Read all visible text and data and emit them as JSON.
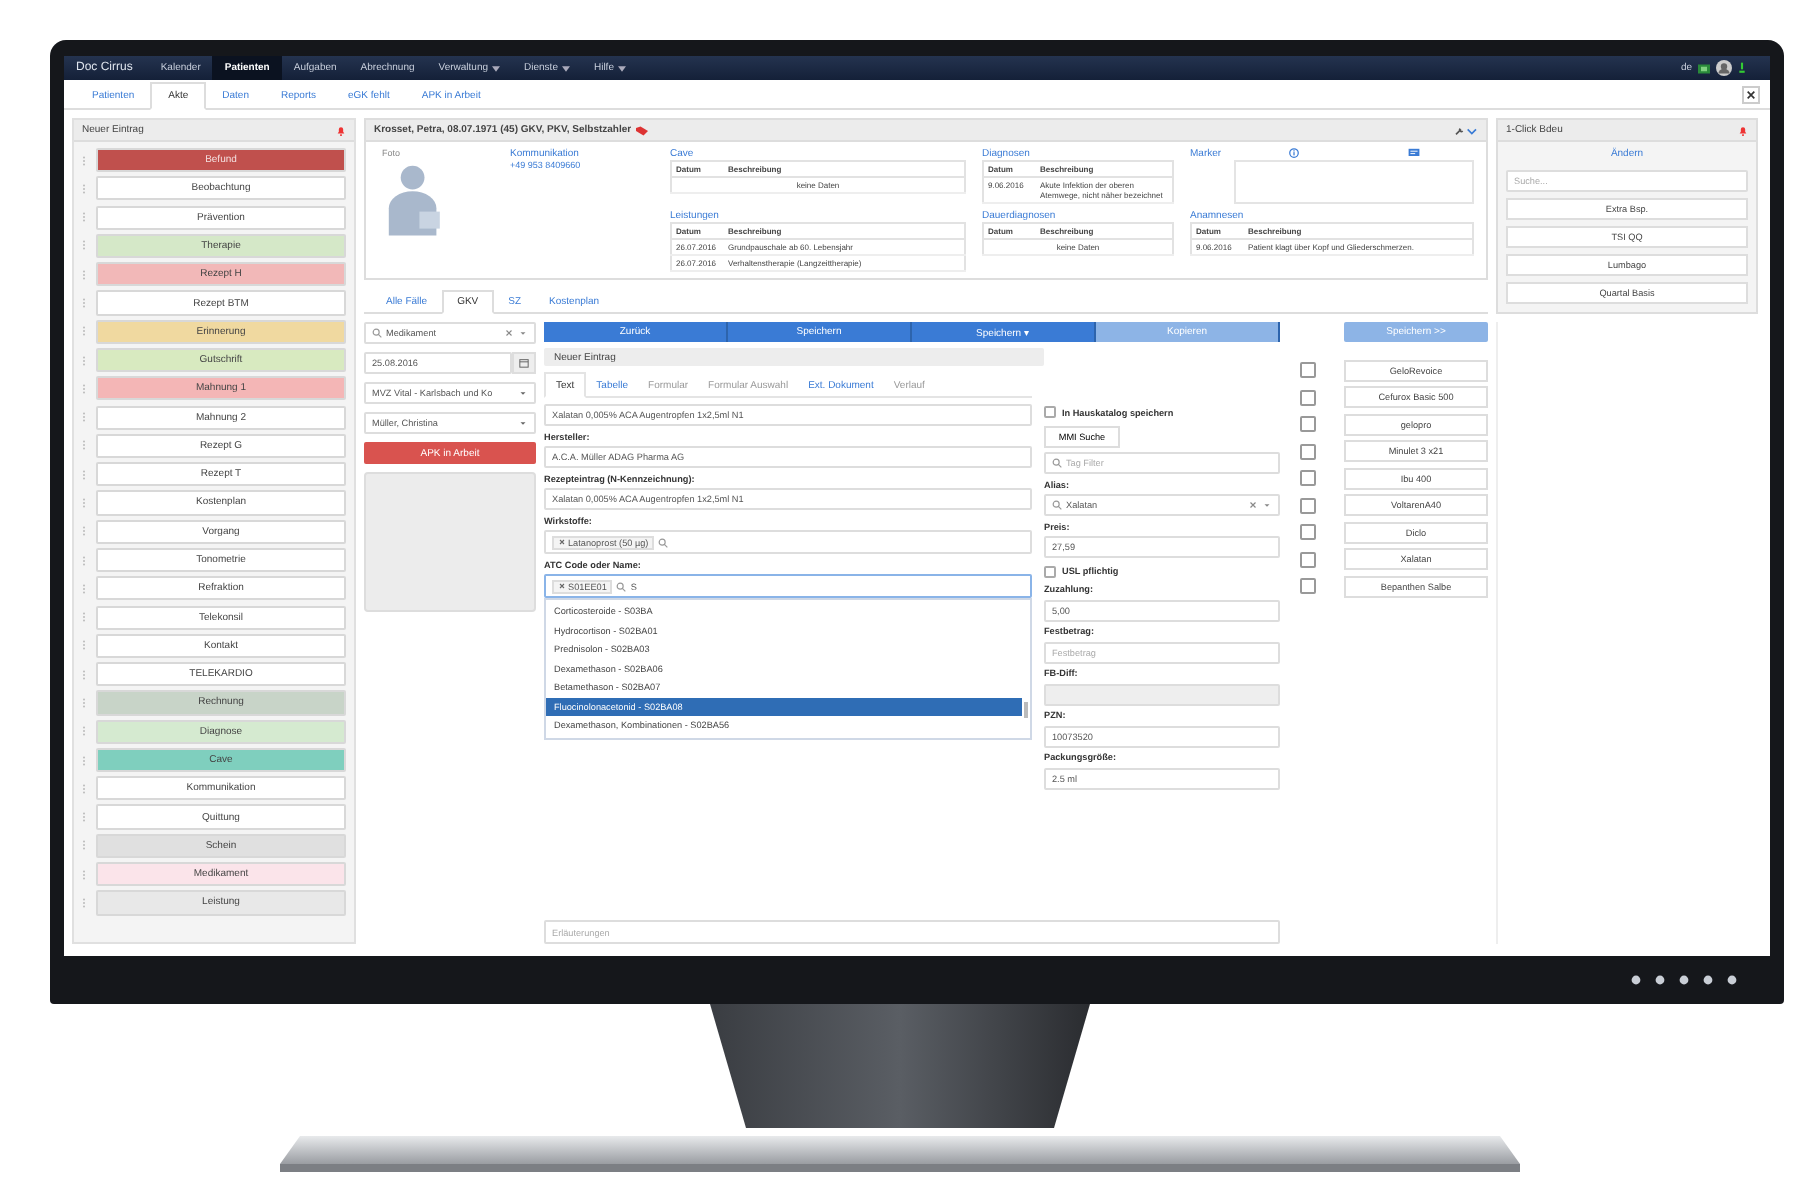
{
  "app_name": "Doc Cirrus",
  "nav": [
    {
      "label": "Kalender",
      "selected": false,
      "dropdown": false
    },
    {
      "label": "Patienten",
      "selected": true,
      "dropdown": false
    },
    {
      "label": "Aufgaben",
      "selected": false,
      "dropdown": false
    },
    {
      "label": "Abrechnung",
      "selected": false,
      "dropdown": false
    },
    {
      "label": "Verwaltung",
      "selected": false,
      "dropdown": true
    },
    {
      "label": "Dienste",
      "selected": false,
      "dropdown": true
    },
    {
      "label": "Hilfe",
      "selected": false,
      "dropdown": true
    }
  ],
  "language": "de",
  "subtabs": [
    {
      "label": "Patienten",
      "selected": false
    },
    {
      "label": "Akte",
      "selected": true
    },
    {
      "label": "Daten",
      "selected": false
    },
    {
      "label": "Reports",
      "selected": false
    },
    {
      "label": "eGK fehlt",
      "selected": false
    },
    {
      "label": "APK in Arbeit",
      "selected": false
    }
  ],
  "new_entry_panel": {
    "title": "Neuer Eintrag",
    "items": [
      {
        "label": "Befund",
        "color": "#c0504d"
      },
      {
        "label": "Beobachtung",
        "color": "#ffffff"
      },
      {
        "label": "Prävention",
        "color": "#ffffff"
      },
      {
        "label": "Therapie",
        "color": "#d5e8c8"
      },
      {
        "label": "Rezept H",
        "color": "#f2b8b8"
      },
      {
        "label": "Rezept BTM",
        "color": "#ffffff"
      },
      {
        "label": "Erinnerung",
        "color": "#f0d9a0"
      },
      {
        "label": "Gutschrift",
        "color": "#d8eac0"
      },
      {
        "label": "Mahnung 1",
        "color": "#f4b6b6"
      },
      {
        "label": "Mahnung 2",
        "color": "#ffffff"
      },
      {
        "label": "Rezept G",
        "color": "#ffffff"
      },
      {
        "label": "Rezept T",
        "color": "#ffffff"
      },
      {
        "label": "Kostenplan",
        "color": "#ffffff"
      },
      {
        "label": "Vorgang",
        "color": "#ffffff"
      },
      {
        "label": "Tonometrie",
        "color": "#ffffff"
      },
      {
        "label": "Refraktion",
        "color": "#ffffff"
      },
      {
        "label": "Telekonsil",
        "color": "#ffffff"
      },
      {
        "label": "Kontakt",
        "color": "#ffffff"
      },
      {
        "label": "TELEKARDIO",
        "color": "#ffffff"
      },
      {
        "label": "Rechnung",
        "color": "#c8d4c8"
      },
      {
        "label": "Diagnose",
        "color": "#d5ead0"
      },
      {
        "label": "Cave",
        "color": "#7fcfbe"
      },
      {
        "label": "Kommunikation",
        "color": "#ffffff"
      },
      {
        "label": "Quittung",
        "color": "#ffffff"
      },
      {
        "label": "Schein",
        "color": "#e0e0e0"
      },
      {
        "label": "Medikament",
        "color": "#fbe4ea"
      },
      {
        "label": "Leistung",
        "color": "#e8e8e8"
      }
    ]
  },
  "patient": {
    "title": "Krosset, Petra, 08.07.1971 (45) GKV, PKV, Selbstzahler",
    "photo_label": "Foto",
    "communication": {
      "title": "Kommunikation",
      "phone": "+49 953 8409660"
    },
    "sections": [
      {
        "title": "Cave",
        "columns": [
          "Datum",
          "Beschreibung"
        ],
        "empty_text": "keine Daten"
      },
      {
        "title": "Diagnosen",
        "columns": [
          "Datum",
          "Beschreibung"
        ],
        "rows": [
          [
            "9.06.2016",
            "Akute Infektion der oberen Atemwege, nicht näher bezeichnet"
          ]
        ]
      },
      {
        "title": "Leistungen",
        "columns": [
          "Datum",
          "Beschreibung"
        ],
        "rows": [
          [
            "26.07.2016",
            "Grundpauschale ab 60. Lebensjahr"
          ],
          [
            "26.07.2016",
            "Verhaltenstherapie (Langzeittherapie)"
          ]
        ]
      },
      {
        "title": "Dauerdiagnosen",
        "columns": [
          "Datum",
          "Beschreibung"
        ],
        "empty_text": "keine Daten"
      },
      {
        "title": "Anamnesen",
        "columns": [
          "Datum",
          "Beschreibung"
        ],
        "rows": [
          [
            "9.06.2016",
            "Patient klagt über Kopf und Gliederschmerzen."
          ]
        ]
      }
    ],
    "marker_title": "Marker"
  },
  "one_click": {
    "title": "1-Click Bdeu",
    "change": "Ändern",
    "search_placeholder": "Suche...",
    "items": [
      "Extra Bsp.",
      "TSI QQ",
      "Lumbago",
      "Quartal Basis"
    ]
  },
  "case_tabs": [
    {
      "label": "Alle Fälle",
      "selected": false
    },
    {
      "label": "GKV",
      "selected": true
    },
    {
      "label": "SZ",
      "selected": false
    },
    {
      "label": "Kostenplan",
      "selected": false
    }
  ],
  "entry_filters": {
    "type": "Medikament",
    "date": "25.08.2016",
    "location": "MVZ Vital - Karlsbach und Ko",
    "doctor": "Müller, Christina",
    "apk_button": "APK in Arbeit"
  },
  "toolbar": [
    {
      "label": "Zurück",
      "kind": "primary"
    },
    {
      "label": "Speichern",
      "kind": "primary"
    },
    {
      "label": "Speichern ▾",
      "kind": "primary"
    },
    {
      "label": "Kopieren",
      "kind": "light"
    }
  ],
  "entry_title": "Neuer Eintrag",
  "form_tabs": [
    {
      "label": "Text",
      "selected": true,
      "disabled": false
    },
    {
      "label": "Tabelle",
      "selected": false,
      "disabled": false
    },
    {
      "label": "Formular",
      "selected": false,
      "disabled": true
    },
    {
      "label": "Formular Auswahl",
      "selected": false,
      "disabled": true
    },
    {
      "label": "Ext. Dokument",
      "selected": false,
      "disabled": false
    },
    {
      "label": "Verlauf",
      "selected": false,
      "disabled": true
    }
  ],
  "form": {
    "product": "Xalatan 0,005% ACA Augentropfen 1x2,5ml N1",
    "manufacturer": {
      "label": "Hersteller:",
      "value": "A.C.A. Müller ADAG Pharma AG"
    },
    "prescription": {
      "label": "Rezepteintrag (N-Kennzeichnung):",
      "value": "Xalatan 0,005% ACA Augentropfen 1x2,5ml N1"
    },
    "ingredients": {
      "label": "Wirkstoffe:",
      "chip": "Latanoprost (50 µg)"
    },
    "atc": {
      "label": "ATC Code oder Name:",
      "chip": "S01EE01",
      "query": "S",
      "options": [
        {
          "label": "Corticosteroide - S03BA",
          "selected": false
        },
        {
          "label": "Hydrocortison - S02BA01",
          "selected": false
        },
        {
          "label": "Prednisolon - S02BA03",
          "selected": false
        },
        {
          "label": "Dexamethason - S02BA06",
          "selected": false
        },
        {
          "label": "Betamethason - S02BA07",
          "selected": false
        },
        {
          "label": "Fluocinolonacetonid - S02BA08",
          "selected": true
        },
        {
          "label": "Dexamethason, Kombinationen - S02BA56",
          "selected": false
        }
      ]
    },
    "notes_placeholder": "Erläuterungen"
  },
  "form_side": {
    "catalog": {
      "label": "In Hauskatalog speichern",
      "checked": false
    },
    "mmi_button": "MMI Suche",
    "tag_placeholder": "Tag Filter",
    "alias": {
      "label": "Alias:",
      "value": "Xalatan"
    },
    "price": {
      "label": "Preis:",
      "value": "27,59"
    },
    "usl": {
      "label": "USL pflichtig",
      "checked": false
    },
    "copay": {
      "label": "Zuzahlung:",
      "value": "5,00"
    },
    "fixed": {
      "label": "Festbetrag:",
      "placeholder": "Festbetrag"
    },
    "fbdiff": {
      "label": "FB-Diff:",
      "disabled": true
    },
    "pzn": {
      "label": "PZN:",
      "value": "10073520"
    },
    "pack": {
      "label": "Packungsgröße:",
      "value": "2.5 ml"
    }
  },
  "quick": {
    "save_button": "Speichern >>",
    "items": [
      {
        "label": "GeloRevoice",
        "checked": false
      },
      {
        "label": "Cefurox Basic 500",
        "checked": false
      },
      {
        "label": "gelopro",
        "checked": false
      },
      {
        "label": "Minulet 3 x21",
        "checked": false
      },
      {
        "label": "Ibu 400",
        "checked": false
      },
      {
        "label": "VoltarenA40",
        "checked": false
      },
      {
        "label": "Diclo",
        "checked": false
      },
      {
        "label": "Xalatan",
        "checked": false
      },
      {
        "label": "Bepanthen Salbe",
        "checked": false
      }
    ]
  }
}
